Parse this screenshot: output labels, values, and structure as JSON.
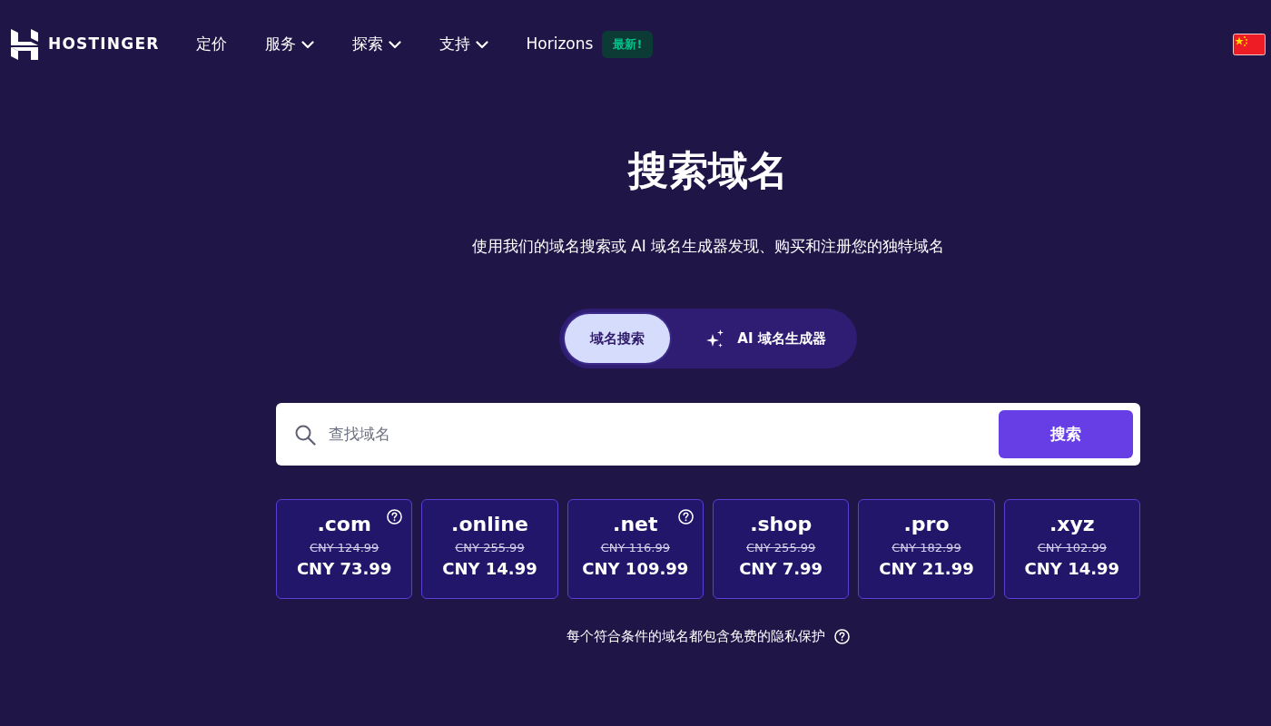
{
  "navbar": {
    "logo": "HOSTINGER",
    "links": [
      {
        "label": "定价",
        "dropdown": false
      },
      {
        "label": "服务",
        "dropdown": true
      },
      {
        "label": "探索",
        "dropdown": true
      },
      {
        "label": "支持",
        "dropdown": true
      },
      {
        "label": "Horizons",
        "dropdown": false,
        "badge": "最新!"
      }
    ]
  },
  "hero": {
    "title": "搜索域名",
    "subtitle": "使用我们的域名搜索或 AI 域名生成器发现、购买和注册您的独特域名"
  },
  "mode_tabs": [
    {
      "label": "域名搜索",
      "selected": true,
      "kind": "plain"
    },
    {
      "label": "AI 域名生成器",
      "selected": false,
      "kind": "ai"
    }
  ],
  "search": {
    "placeholder": "查找域名",
    "button": "搜索"
  },
  "tlds": [
    {
      "name": ".com",
      "old_price": "CNY 124.99",
      "price": "CNY 73.99",
      "info": true
    },
    {
      "name": ".online",
      "old_price": "CNY 255.99",
      "price": "CNY 14.99",
      "info": false
    },
    {
      "name": ".net",
      "old_price": "CNY 116.99",
      "price": "CNY 109.99",
      "info": true
    },
    {
      "name": ".shop",
      "old_price": "CNY 255.99",
      "price": "CNY 7.99",
      "info": false
    },
    {
      "name": ".pro",
      "old_price": "CNY 182.99",
      "price": "CNY 21.99",
      "info": false
    },
    {
      "name": ".xyz",
      "old_price": "CNY 102.99",
      "price": "CNY 14.99",
      "info": false
    }
  ],
  "footnote": "每个符合条件的域名都包含免费的隐私保护"
}
